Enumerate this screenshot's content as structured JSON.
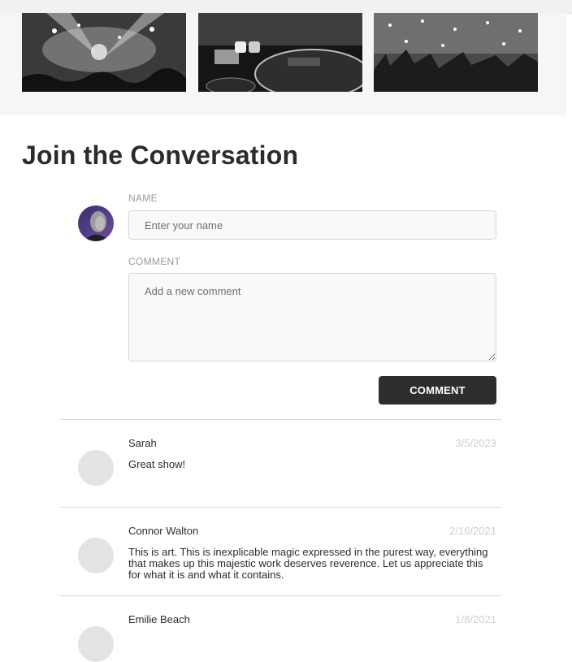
{
  "gallery": {
    "images": [
      {
        "alt": "concert crowd with stage lights"
      },
      {
        "alt": "DJ turntable controls"
      },
      {
        "alt": "crowd with confetti"
      }
    ]
  },
  "conversation": {
    "title": "Join the Conversation",
    "form": {
      "name_label": "NAME",
      "name_placeholder": "Enter your name",
      "comment_label": "COMMENT",
      "comment_placeholder": "Add a new comment",
      "submit_label": "COMMENT"
    },
    "comments": [
      {
        "author": "Sarah",
        "date": "3/5/2023",
        "text": "Great show!"
      },
      {
        "author": "Connor Walton",
        "date": "2/16/2021",
        "text": "This is art. This is inexplicable magic expressed in the purest way, everything that makes up this majestic work deserves reverence. Let us appreciate this for what it is and what it contains."
      },
      {
        "author": "Emilie Beach",
        "date": "1/8/2021",
        "text": ""
      }
    ]
  }
}
